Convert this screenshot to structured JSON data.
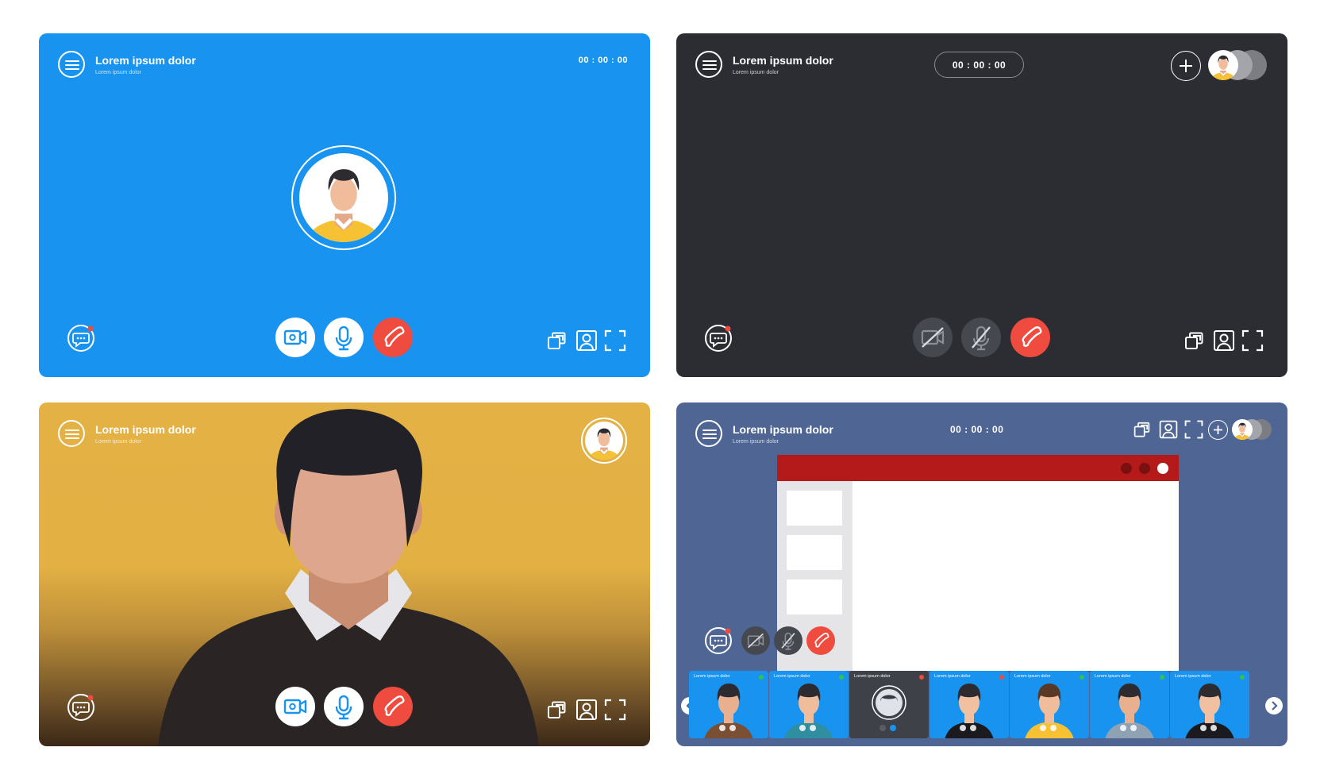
{
  "panels": {
    "p1": {
      "title": "Lorem ipsum dolor",
      "subtitle": "Lorem ipsum dolor",
      "timer": "00 : 00 : 00"
    },
    "p2": {
      "title": "Lorem ipsum dolor",
      "subtitle": "Lorem ipsum dolor",
      "timer": "00 : 00 : 00"
    },
    "p3": {
      "title": "Lorem ipsum dolor",
      "subtitle": "Lorem ipsum dolor"
    },
    "p4": {
      "title": "Lorem ipsum dolor",
      "subtitle": "Lorem ipsum dolor",
      "timer": "00 : 00 : 00"
    }
  },
  "participants": [
    {
      "label": "Lorem ipsum dolor",
      "status": "green"
    },
    {
      "label": "Lorem ipsum dolor",
      "status": "green"
    },
    {
      "label": "Lorem ipsum dolor",
      "status": "red"
    },
    {
      "label": "Lorem ipsum dolor",
      "status": "red"
    },
    {
      "label": "Lorem ipsum dolor",
      "status": "green"
    },
    {
      "label": "Lorem ipsum dolor",
      "status": "green"
    },
    {
      "label": "Lorem ipsum dolor",
      "status": "green"
    }
  ],
  "icons": [
    "menu-icon",
    "chat-icon",
    "camera-icon",
    "microphone-icon",
    "end-call-icon",
    "camera-off-icon",
    "microphone-off-icon",
    "switch-window-icon",
    "contact-icon",
    "fullscreen-icon",
    "add-icon",
    "chevron-left-icon",
    "chevron-right-icon"
  ],
  "colors": {
    "blue": "#1894f0",
    "dark": "#2c2d33",
    "yellow": "#e3b144",
    "slate": "#4f6694",
    "red": "#ef4b3f",
    "shared_window_bar": "#b51a1a",
    "status_green": "#35c24a",
    "status_red": "#ef4b3f"
  }
}
